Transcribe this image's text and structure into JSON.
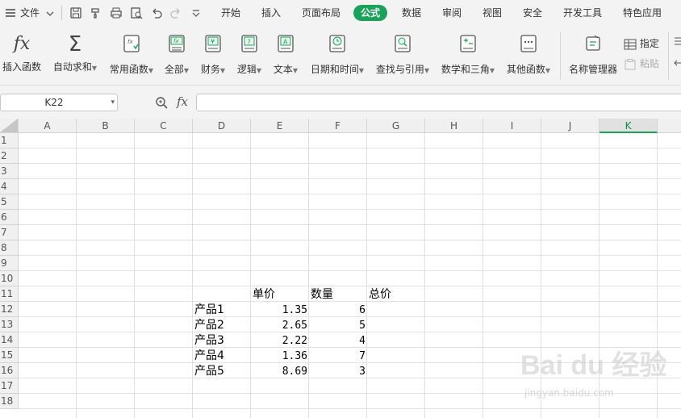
{
  "menubar": {
    "file_label": "文件",
    "tabs": [
      "开始",
      "插入",
      "页面布局",
      "公式",
      "数据",
      "审阅",
      "视图",
      "安全",
      "开发工具",
      "特色应用"
    ],
    "active_tab": "公式"
  },
  "ribbon": {
    "buttons": [
      {
        "label": "插入函数",
        "dropdown": false,
        "icon": "fx-icon"
      },
      {
        "label": "自动求和",
        "dropdown": true,
        "icon": "sigma-icon"
      },
      {
        "label": "常用函数",
        "dropdown": true,
        "icon": "common-functions-icon"
      },
      {
        "label": "全部",
        "dropdown": true,
        "icon": "all-functions-icon"
      },
      {
        "label": "财务",
        "dropdown": true,
        "icon": "finance-icon"
      },
      {
        "label": "逻辑",
        "dropdown": true,
        "icon": "logic-icon"
      },
      {
        "label": "文本",
        "dropdown": true,
        "icon": "text-icon"
      },
      {
        "label": "日期和时间",
        "dropdown": true,
        "icon": "clock-icon"
      },
      {
        "label": "查找与引用",
        "dropdown": true,
        "icon": "lookup-icon"
      },
      {
        "label": "数学和三角",
        "dropdown": true,
        "icon": "math-icon"
      },
      {
        "label": "其他函数",
        "dropdown": true,
        "icon": "more-functions-icon"
      },
      {
        "label": "名称管理器",
        "dropdown": false,
        "icon": "name-manager-icon"
      }
    ],
    "side": {
      "define_label": "指定",
      "paste_label": "粘贴"
    }
  },
  "formula_bar": {
    "name_box": "K22",
    "fx_label": "fx",
    "formula": ""
  },
  "grid": {
    "columns": [
      "A",
      "B",
      "C",
      "D",
      "E",
      "F",
      "G",
      "H",
      "I",
      "J",
      "K"
    ],
    "selected_column": "K",
    "rows": [
      "1",
      "2",
      "3",
      "4",
      "5",
      "6",
      "7",
      "8",
      "9",
      "10",
      "11",
      "12",
      "13",
      "14",
      "15",
      "16",
      "17",
      "18"
    ],
    "header_row": {
      "price": "单价",
      "qty": "数量",
      "total": "总价"
    },
    "products": [
      {
        "name": "产品1",
        "price": "1.35",
        "qty": "6"
      },
      {
        "name": "产品2",
        "price": "2.65",
        "qty": "5"
      },
      {
        "name": "产品3",
        "price": "2.22",
        "qty": "4"
      },
      {
        "name": "产品4",
        "price": "1.36",
        "qty": "7"
      },
      {
        "name": "产品5",
        "price": "8.69",
        "qty": "3"
      }
    ]
  },
  "watermark": {
    "brand": "Bai du 经验",
    "url": "jingyan.baidu.com"
  },
  "colors": {
    "accent": "#1aa25a"
  }
}
